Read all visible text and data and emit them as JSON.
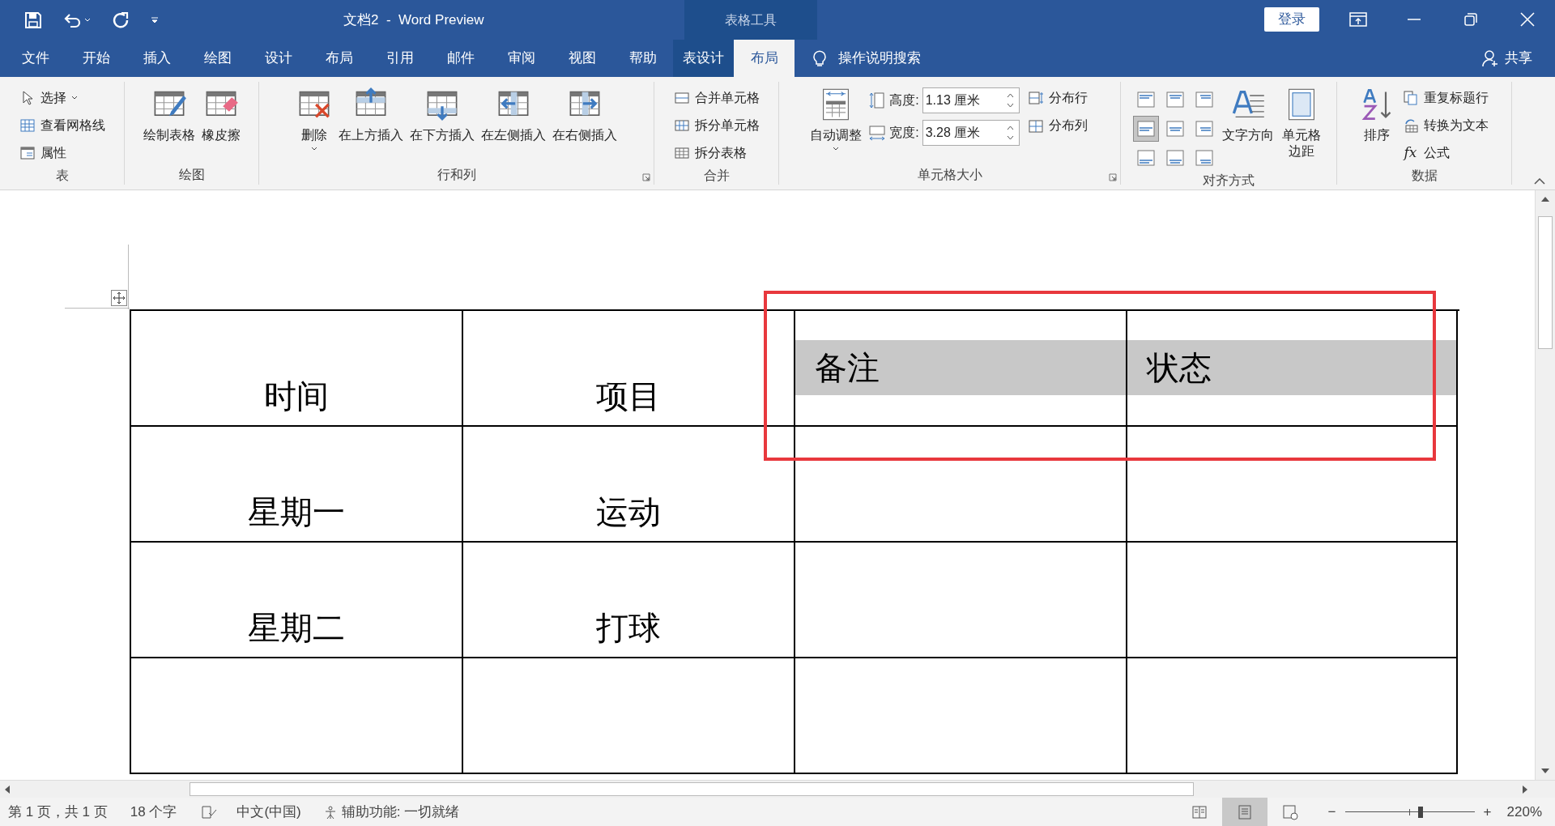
{
  "window": {
    "title": "文档2  -  Word Preview",
    "contextual_title": "表格工具",
    "sign_in": "登录"
  },
  "menu_tabs": [
    {
      "label": "文件",
      "selected": false
    },
    {
      "label": "开始",
      "selected": false
    },
    {
      "label": "插入",
      "selected": false
    },
    {
      "label": "绘图",
      "selected": false
    },
    {
      "label": "设计",
      "selected": false
    },
    {
      "label": "布局",
      "selected": false
    },
    {
      "label": "引用",
      "selected": false
    },
    {
      "label": "邮件",
      "selected": false
    },
    {
      "label": "审阅",
      "selected": false
    },
    {
      "label": "视图",
      "selected": false
    },
    {
      "label": "帮助",
      "selected": false
    },
    {
      "label": "表设计",
      "selected": false,
      "contextual": true
    },
    {
      "label": "布局",
      "selected": true,
      "contextual": true
    }
  ],
  "tell_me": "操作说明搜索",
  "share": "共享",
  "ribbon_groups": [
    {
      "label": "表",
      "items": [
        {
          "kind": "small",
          "label": "选择",
          "dropdown": true
        },
        {
          "kind": "small",
          "label": "查看网格线"
        },
        {
          "kind": "small",
          "label": "属性"
        }
      ]
    },
    {
      "label": "绘图",
      "items": [
        {
          "kind": "large",
          "label": "绘制表格"
        },
        {
          "kind": "large",
          "label": "橡皮擦"
        }
      ]
    },
    {
      "label": "行和列",
      "launcher": true,
      "items": [
        {
          "kind": "large",
          "label": "删除",
          "dropdown": true
        },
        {
          "kind": "large",
          "label": "在上方插入"
        },
        {
          "kind": "large",
          "label": "在下方插入"
        },
        {
          "kind": "large",
          "label": "在左侧插入"
        },
        {
          "kind": "large",
          "label": "在右侧插入"
        }
      ]
    },
    {
      "label": "合并",
      "items": [
        {
          "kind": "small",
          "label": "合并单元格"
        },
        {
          "kind": "small",
          "label": "拆分单元格"
        },
        {
          "kind": "small",
          "label": "拆分表格"
        }
      ]
    },
    {
      "label": "单元格大小",
      "launcher": true,
      "items": [
        {
          "kind": "large",
          "label": "自动调整",
          "dropdown": true
        },
        {
          "kind": "spinner",
          "label": "高度:",
          "value": "1.13 厘米"
        },
        {
          "kind": "spinner",
          "label": "宽度:",
          "value": "3.28 厘米"
        },
        {
          "kind": "small",
          "label": "分布行"
        },
        {
          "kind": "small",
          "label": "分布列"
        }
      ]
    },
    {
      "label": "对齐方式",
      "items": [
        {
          "kind": "align",
          "selected": false
        },
        {
          "kind": "align",
          "selected": false
        },
        {
          "kind": "align",
          "selected": false
        },
        {
          "kind": "align",
          "selected": true
        },
        {
          "kind": "align",
          "selected": false
        },
        {
          "kind": "align",
          "selected": false
        },
        {
          "kind": "align",
          "selected": false
        },
        {
          "kind": "align",
          "selected": false
        },
        {
          "kind": "align",
          "selected": false
        },
        {
          "kind": "large",
          "label": "文字方向"
        },
        {
          "kind": "large",
          "label": "单元格边距",
          "narrow": true
        }
      ]
    },
    {
      "label": "数据",
      "items": [
        {
          "kind": "large",
          "label": "排序"
        },
        {
          "kind": "small",
          "label": "重复标题行"
        },
        {
          "kind": "small",
          "label": "转换为文本"
        },
        {
          "kind": "small",
          "label": "公式",
          "icon_text": "fx"
        }
      ]
    }
  ],
  "table": {
    "rows": [
      [
        {
          "text": "时间",
          "selected": false
        },
        {
          "text": "项目",
          "selected": false
        },
        {
          "text": "备注",
          "selected": true
        },
        {
          "text": "状态",
          "selected": true
        }
      ],
      [
        {
          "text": "星期一",
          "selected": false
        },
        {
          "text": "运动",
          "selected": false
        },
        {
          "selected": false
        },
        {
          "selected": false
        }
      ],
      [
        {
          "text": "星期二",
          "selected": false
        },
        {
          "text": "打球",
          "selected": false
        },
        {
          "selected": false
        },
        {
          "selected": false
        }
      ],
      [
        {
          "selected": false
        },
        {
          "selected": false
        },
        {
          "selected": false
        },
        {
          "selected": false
        }
      ]
    ]
  },
  "highlight_frame": true,
  "status_bar": {
    "page": "第 1 页，共 1 页",
    "words": "18 个字",
    "language": "中文(中国)",
    "accessibility": "辅助功能: 一切就绪",
    "views": [
      {
        "selected": false
      },
      {
        "selected": true
      },
      {
        "selected": false
      }
    ],
    "zoom_out": "−",
    "zoom_in": "+",
    "zoom_slider": {
      "level": 0.59
    },
    "zoom": "220%"
  }
}
